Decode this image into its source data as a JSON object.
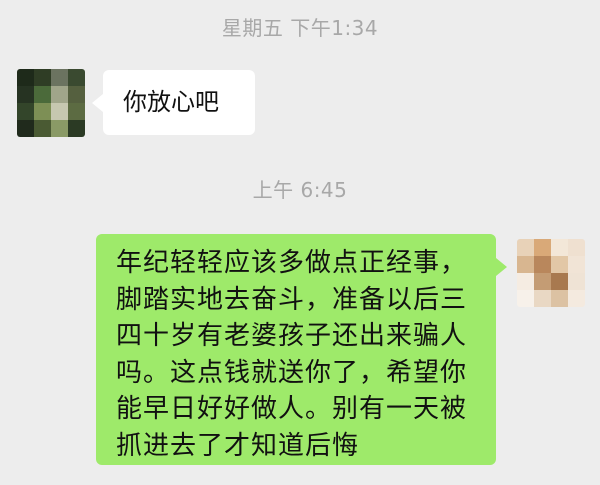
{
  "chat": {
    "timestamp_1": "星期五 下午1:34",
    "timestamp_2": "上午 6:45",
    "messages": [
      {
        "sender": "other",
        "text": "你放心吧"
      },
      {
        "sender": "self",
        "lines": [
          "年纪轻轻应该多做点正经事，",
          "脚踏实地去奋斗，准备以后三",
          "四十岁有老婆孩子还出来骗人",
          "吗。这点钱就送你了，希望你",
          "能早日好好做人。别有一天被",
          "抓进去了才知道后悔"
        ]
      }
    ]
  },
  "avatars": {
    "left_colors": [
      "#1e2a1a",
      "#2f3d25",
      "#6b7360",
      "#3a4a30",
      "#263322",
      "#4b6a3a",
      "#a0a58a",
      "#55603f",
      "#33452a",
      "#7d8f55",
      "#c6c7b0",
      "#5c6b42",
      "#202a1c",
      "#4a5a33",
      "#8a9a66",
      "#2b3a24"
    ],
    "right_colors": [
      "#e8d2b8",
      "#d9a978",
      "#f3e7d8",
      "#efe0d0",
      "#d8b690",
      "#b9875c",
      "#e2c7a6",
      "#f1e4d6",
      "#f5ece2",
      "#c49c74",
      "#a8794f",
      "#efe3d5",
      "#f7f1ea",
      "#e9d8c4",
      "#dcc2a3",
      "#f4eadf"
    ]
  }
}
